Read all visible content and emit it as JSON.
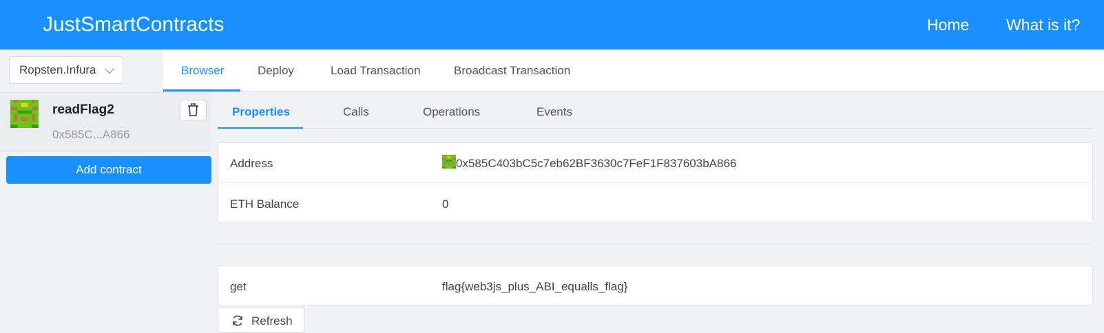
{
  "header": {
    "brand": "JustSmartContracts",
    "nav": [
      "Home",
      "What is it?"
    ]
  },
  "sidebar": {
    "network": "Ropsten.Infura",
    "contract": {
      "name": "readFlag2",
      "address_short": "0x585C...A866",
      "avatar_icon": "identicon"
    },
    "add_label": "Add contract",
    "trash_icon": "trash-icon"
  },
  "top_tabs": [
    "Browser",
    "Deploy",
    "Load Transaction",
    "Broadcast Transaction"
  ],
  "sub_tabs": [
    "Properties",
    "Calls",
    "Operations",
    "Events"
  ],
  "properties": [
    {
      "label": "Address",
      "value": "0x585C403bC5c7eb62BF3630c7FeF1F837603bA866"
    },
    {
      "label": "ETH Balance",
      "value": "0"
    }
  ],
  "calls": [
    {
      "label": "get",
      "value": "flag{web3js_plus_ABI_equalls_flag}"
    }
  ],
  "refresh_label": "Refresh",
  "colors": {
    "primary": "#1890ff",
    "identicon_green": "#6cc61a",
    "identicon_brown": "#b77a44"
  }
}
